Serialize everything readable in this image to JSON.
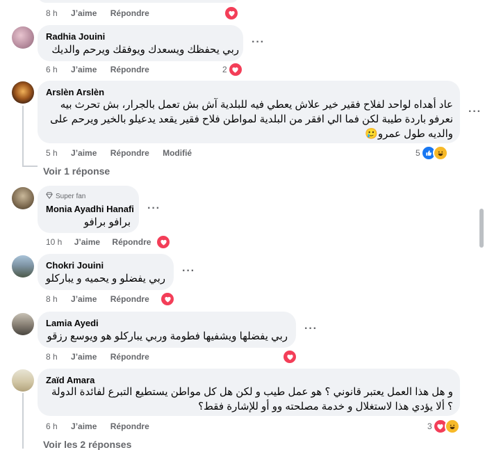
{
  "actions": {
    "like": "J’aime",
    "reply": "Répondre",
    "edited": "Modifié"
  },
  "top": {
    "time": "8 h"
  },
  "comments": [
    {
      "name": "Radhia Jouini",
      "text": [
        "ربي يحفظك ويسعدك ويوفقك ويرحم والديك"
      ],
      "time": "6 h",
      "count": "2"
    },
    {
      "name": "Arslèn Arslèn",
      "text": [
        "عاد أهداه لواحد لفلاح فقير خير علاش يعطي فيه للبلدية آش بش تعمل بالجرار، بش تحرث بيه",
        "نعرفو باردة طيبة لكن فما الي افقر من البلدية لمواطن فلاح فقير يقعد يدعيلو بالخير ويرحم على",
        "والديه طول عمرو🥲"
      ],
      "time": "5 h",
      "count": "5",
      "replies": "Voir 1 réponse"
    },
    {
      "name": "Monia Ayadhi Hanafi",
      "badge": "Super fan",
      "text": [
        "برافو برافو"
      ],
      "time": "10 h"
    },
    {
      "name": "Chokri Jouini",
      "text": [
        "ربي يفضلو و يحميه و يباركلو"
      ],
      "time": "8 h"
    },
    {
      "name": "Lamia Ayedi",
      "text": [
        "ربي يفضلها ويشفيها فطومة وربي يباركلو هو ويوسع رزقو"
      ],
      "time": "8 h"
    },
    {
      "name": "Zaïd Amara",
      "text": [
        "و هل هذا العمل يعتبر قانوني ؟ هو عمل طيب و لكن هل كل مواطن يستطيع التبرع لفائدة الدولة",
        "؟ ألا يؤدي هذا لاستغلال و خدمة مصلحته وو أو للإشارة فقط؟"
      ],
      "time": "6 h",
      "count": "3",
      "replies": "Voir les 2 réponses"
    }
  ],
  "colors": {
    "heart": "#f33e58",
    "like": "#1877f2",
    "laugh": "#f7b928",
    "bubble": "#f0f2f5"
  },
  "icons": [
    "heart-reaction-icon",
    "like-reaction-icon",
    "haha-reaction-icon",
    "more-options-icon",
    "diamond-icon"
  ]
}
